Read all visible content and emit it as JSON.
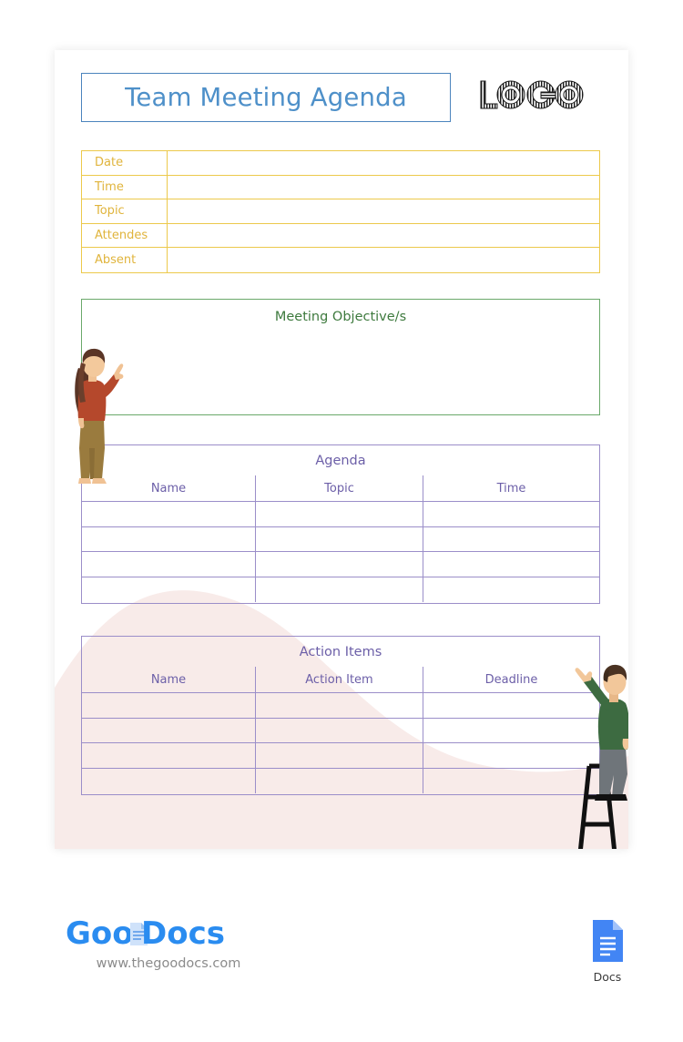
{
  "document": {
    "title": "Team Meeting Agenda",
    "logo_placeholder": "LOGO"
  },
  "info_table": {
    "rows": [
      {
        "label": "Date",
        "value": ""
      },
      {
        "label": "Time",
        "value": ""
      },
      {
        "label": "Topic",
        "value": ""
      },
      {
        "label": "Attendes",
        "value": ""
      },
      {
        "label": "Absent",
        "value": ""
      }
    ]
  },
  "objectives": {
    "title": "Meeting Objective/s",
    "body": ""
  },
  "agenda": {
    "title": "Agenda",
    "columns": [
      "Name",
      "Topic",
      "Time"
    ],
    "rows": [
      [
        "",
        "",
        ""
      ],
      [
        "",
        "",
        ""
      ],
      [
        "",
        "",
        ""
      ],
      [
        "",
        "",
        ""
      ]
    ]
  },
  "action_items": {
    "title": "Action Items",
    "columns": [
      "Name",
      "Action Item",
      "Deadline"
    ],
    "rows": [
      [
        "",
        "",
        ""
      ],
      [
        "",
        "",
        ""
      ],
      [
        "",
        "",
        ""
      ],
      [
        "",
        "",
        ""
      ]
    ]
  },
  "footer": {
    "brand": "GooDocs",
    "brand_part_1": "Goo",
    "brand_part_2": "Docs",
    "url": "www.thegoodocs.com",
    "docs_label": "Docs"
  },
  "colors": {
    "title_blue": "#4e90c9",
    "gold": "#ecc94b",
    "gold_text": "#e0b43c",
    "green": "#6aa96a",
    "green_text": "#3e7a3e",
    "purple": "#9b8ec9",
    "purple_text": "#6c5fa8",
    "wave_pink": "#f8ebe9",
    "brand_blue": "#2a8cf0",
    "docs_blue": "#4285f4"
  }
}
